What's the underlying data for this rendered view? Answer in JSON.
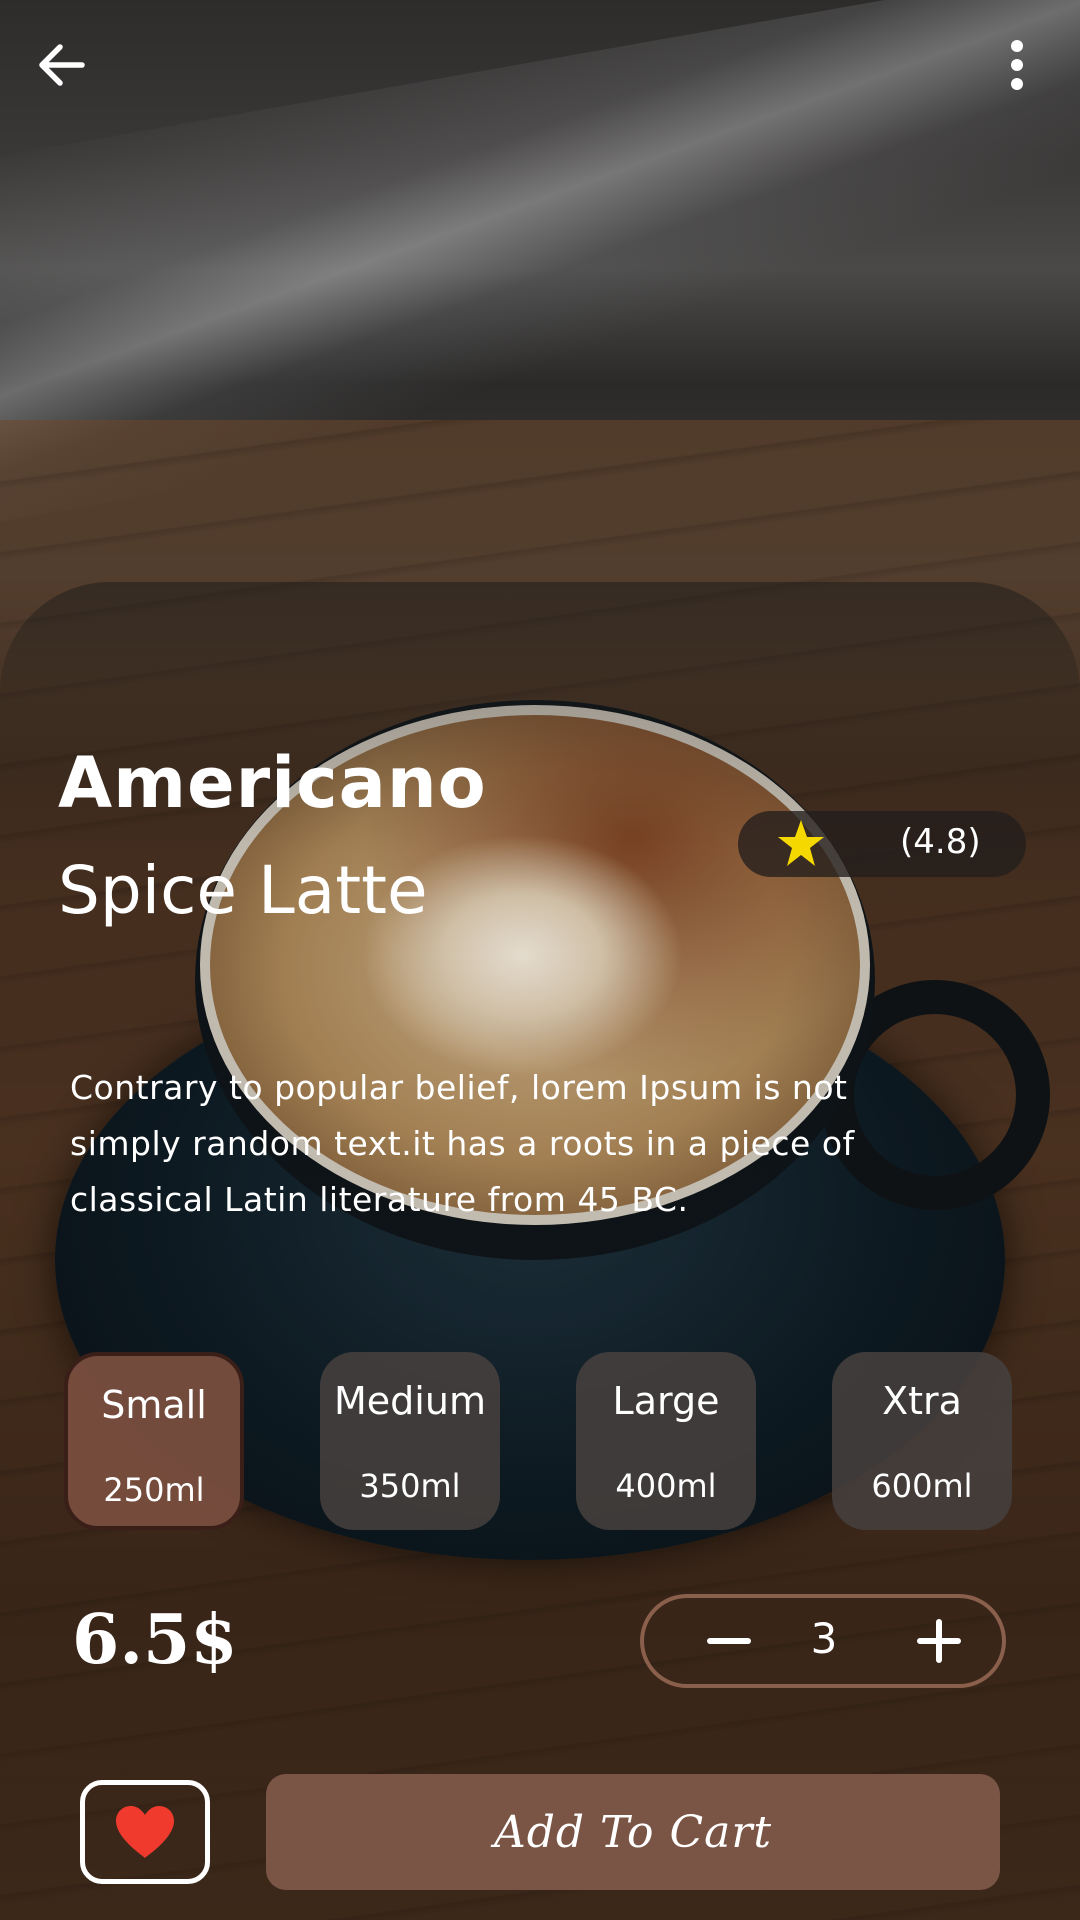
{
  "product": {
    "name": "Americano",
    "variant": "Spice Latte",
    "rating": "(4.8)",
    "description": "Contrary to popular belief, lorem Ipsum is not simply random text.it has a roots in a piece of classical Latin literature from 45 BC."
  },
  "sizes": [
    {
      "name": "Small",
      "volume": "250ml",
      "selected": true
    },
    {
      "name": "Medium",
      "volume": "350ml",
      "selected": false
    },
    {
      "name": "Large",
      "volume": "400ml",
      "selected": false
    },
    {
      "name": "Xtra",
      "volume": "600ml",
      "selected": false
    }
  ],
  "price": "6.5$",
  "quantity": "3",
  "actions": {
    "add_to_cart_label": "Add To Cart"
  },
  "icons": {
    "back": "arrow-left-icon",
    "more": "more-vertical-icon",
    "rating": "star-icon",
    "favorite": "heart-icon",
    "decrease": "minus-icon",
    "increase": "plus-icon"
  },
  "colors": {
    "accent_brown": "#7a5444",
    "selected_size_bg": "#784e3e",
    "stepper_border": "#8a5f4c",
    "star": "#f5d800",
    "heart": "#f03a2e"
  }
}
